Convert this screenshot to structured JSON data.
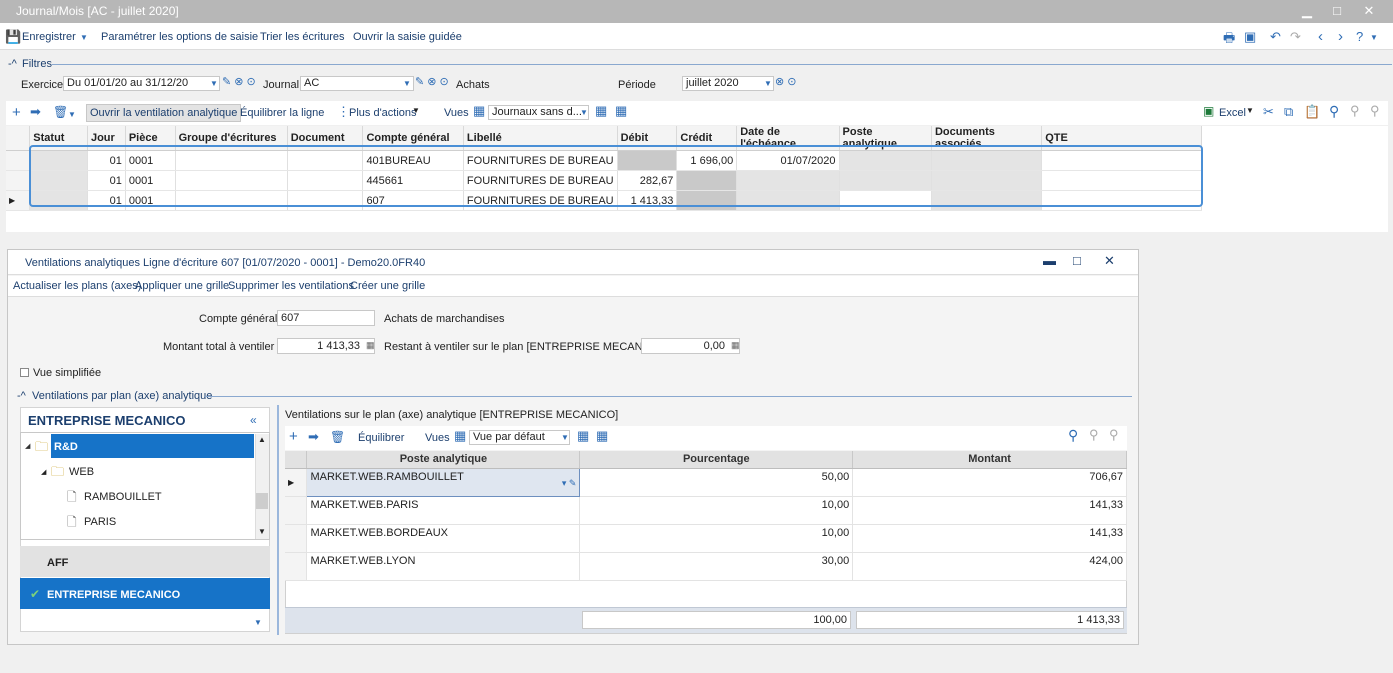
{
  "window": {
    "title": "Journal/Mois [AC - juillet 2020]"
  },
  "menu": {
    "save": "Enregistrer",
    "params": "Paramétrer les options de saisie",
    "sort": "Trier les écritures",
    "guided": "Ouvrir la saisie guidée"
  },
  "filters": {
    "section": "Filtres",
    "exercice_label": "Exercice",
    "exercice_value": "Du 01/01/20 au 31/12/20",
    "journal_label": "Journal",
    "journal_value": "AC",
    "journal_name": "Achats",
    "periode_label": "Période",
    "periode_value": "juillet 2020"
  },
  "toolbar": {
    "open_analytics": "Ouvrir la ventilation analytique",
    "balance": "Équilibrer la ligne",
    "more": "Plus d'actions",
    "views_label": "Vues",
    "views_value": "Journaux sans d...",
    "excel": "Excel"
  },
  "grid": {
    "columns": [
      "Statut",
      "Jour",
      "Pièce",
      "Groupe d'écritures",
      "Document",
      "Compte général",
      "Libellé",
      "Débit",
      "Crédit",
      "Date de l'échéance",
      "Poste analytique",
      "Documents associés",
      "QTE"
    ],
    "rows": [
      {
        "jour": "01",
        "piece": "0001",
        "compte": "401BUREAU",
        "libelle": "FOURNITURES DE BUREAU",
        "debit": "",
        "credit": "1 696,00",
        "echeance": "01/07/2020"
      },
      {
        "jour": "01",
        "piece": "0001",
        "compte": "445661",
        "libelle": "FOURNITURES DE BUREAU",
        "debit": "282,67",
        "credit": "",
        "echeance": ""
      },
      {
        "jour": "01",
        "piece": "0001",
        "compte": "607",
        "libelle": "FOURNITURES DE BUREAU",
        "debit": "1 413,33",
        "credit": "",
        "echeance": ""
      }
    ]
  },
  "dialog": {
    "title": "Ventilations analytiques Ligne d'écriture 607 [01/07/2020 - 0001] - Demo20.0FR40",
    "actions": [
      "Actualiser les plans (axes)",
      "Appliquer une grille",
      "Supprimer les ventilations",
      "Créer une grille"
    ],
    "compte_label": "Compte général",
    "compte_value": "607",
    "compte_name": "Achats de marchandises",
    "montant_label": "Montant total à ventiler",
    "montant_value": "1 413,33",
    "restant_label": "Restant à ventiler sur le plan [ENTREPRISE MECANICO]",
    "restant_value": "0,00",
    "vue_simplifiee": "Vue simplifiée",
    "ventilations_section": "Ventilations par plan (axe) analytique",
    "tree_title": "ENTREPRISE MECANICO",
    "tree_collapse": "«",
    "tree": {
      "rd": "R&D",
      "web": "WEB",
      "rambouillet": "RAMBOUILLET",
      "paris": "PARIS"
    },
    "plans": {
      "aff": "AFF",
      "mecanico": "ENTREPRISE MECANICO"
    },
    "plan_title": "Ventilations sur le plan (axe) analytique [ENTREPRISE MECANICO]",
    "balance": "Équilibrer",
    "views_label": "Vues",
    "views_value": "Vue par défaut",
    "columns": [
      "Poste analytique",
      "Pourcentage",
      "Montant"
    ],
    "rows": [
      {
        "poste": "MARKET.WEB.RAMBOUILLET",
        "pct": "50,00",
        "montant": "706,67"
      },
      {
        "poste": "MARKET.WEB.PARIS",
        "pct": "10,00",
        "montant": "141,33"
      },
      {
        "poste": "MARKET.WEB.BORDEAUX",
        "pct": "10,00",
        "montant": "141,33"
      },
      {
        "poste": "MARKET.WEB.LYON",
        "pct": "30,00",
        "montant": "424,00"
      }
    ],
    "total_pct": "100,00",
    "total_montant": "1 413,33"
  }
}
